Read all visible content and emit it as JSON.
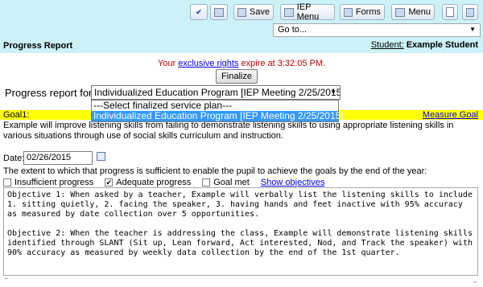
{
  "toolbar": {
    "save_label": "Save",
    "iep_menu_label": "IEP Menu",
    "forms_label": "Forms",
    "menu_label": "Menu"
  },
  "goto": {
    "value": "Go to..."
  },
  "header": {
    "title": "Progress Report",
    "student_label": "Student:",
    "student_name": "Example Student"
  },
  "rights": {
    "prefix": "Your ",
    "link": "exclusive rights",
    "suffix": " expire at 3:32:05 PM."
  },
  "finalize_label": "Finalize",
  "progress_report": {
    "label": "Progress report for:",
    "selected": "Individualized Education Program [IEP Meeting 2/25/2015]",
    "options": [
      "---Select finalized service plan---",
      "Individualized Education Program [IEP Meeting 2/25/2015]"
    ]
  },
  "goal": {
    "label": "Goal1:",
    "measure_link": "Measure Goal",
    "text": "Example will improve listening skills from failing to demonstrate listening skills to using appropriate listening skills in various situations through use of social skills curriculum and instruction."
  },
  "date": {
    "label": "Date:",
    "value": "02/26/2015"
  },
  "extent_text": "The extent to which that progress is sufficient to enable the pupil to achieve the goals by the end of the year:",
  "checks": {
    "insufficient": "Insufficient progress",
    "adequate": "Adequate progress",
    "met": "Goal met",
    "show_objectives": "Show objectives"
  },
  "objectives_text": "Objective 1: When asked by a teacher, Example will verbally list the listening skills to include 1. sitting quietly, 2. facing the speaker, 3. having hands and feet inactive with 95% accuracy as measured by date collection over 5 opportunities.\n\nObjective 2: When the teacher is addressing the class, Example will demonstrate listening skills identified through SLANT (Sit up, Lean forward, Act interested, Nod, and Track the speaker) with 90% accuracy as measured by weekly data collection by the end of the 1st quarter."
}
